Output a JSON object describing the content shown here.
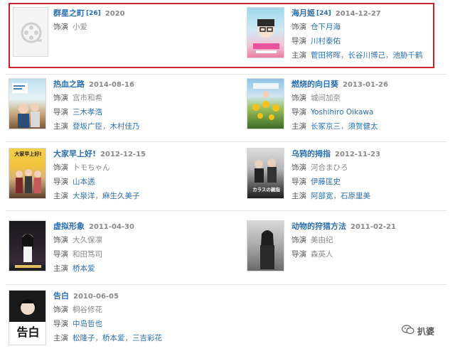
{
  "labels": {
    "voice": "饰演",
    "director": "导演",
    "lead": "主演"
  },
  "films": [
    {
      "title": "群星之町",
      "ref": "[26]",
      "date": "2020",
      "voice": [
        "小爱"
      ],
      "voice_link": false
    },
    {
      "title": "海月姬",
      "ref": "[24]",
      "date": "2014-12-27",
      "voice": [
        "仓下月海"
      ],
      "voice_link": true,
      "director": [
        "川村泰佑"
      ],
      "lead": [
        "菅田将晖",
        "长谷川博己",
        "池胁千鹤"
      ]
    },
    {
      "title": "热血之路",
      "date": "2014-08-16",
      "voice": [
        "宫市和希"
      ],
      "voice_link": false,
      "director": [
        "三木孝浩"
      ],
      "lead": [
        "登坂广臣",
        "木村佳乃"
      ]
    },
    {
      "title": "燃烧的向日葵",
      "date": "2013-01-26",
      "voice": [
        "城间加奈"
      ],
      "voice_link": false,
      "director": [
        "Yoshihiro Oikawa"
      ],
      "lead": [
        "长冢京三",
        "须贺健太"
      ]
    },
    {
      "title": "大家早上好!",
      "date": "2012-12-15",
      "voice": [
        "卜モちゃん"
      ],
      "voice_link": false,
      "director": [
        "山本透"
      ],
      "lead": [
        "大泉洋",
        "麻生久美子"
      ]
    },
    {
      "title": "乌鸦的拇指",
      "date": "2012-11-23",
      "voice": [
        "河合まひろ"
      ],
      "voice_link": false,
      "director": [
        "伊藤匡史"
      ],
      "lead": [
        "阿部宽",
        "石原里美"
      ]
    },
    {
      "title": "虚拟形象",
      "date": "2011-04-30",
      "voice": [
        "大久保凛"
      ],
      "voice_link": false,
      "director": [
        "和田笃司"
      ],
      "lead": [
        "桥本爱"
      ]
    },
    {
      "title": "动物的狩猎方法",
      "date": "2011-02-21",
      "voice": [
        "美由纪"
      ],
      "voice_link": false,
      "director": [
        "森英人"
      ]
    },
    {
      "title": "告白",
      "date": "2010-06-05",
      "voice": [
        "桐谷修花"
      ],
      "voice_link": false,
      "director": [
        "中岛哲也"
      ],
      "lead": [
        "松隆子",
        "桥本爱",
        "三吉彩花"
      ]
    }
  ],
  "posters": {
    "p8_text": "告白",
    "p5_text": "大家早上好!",
    "p6_text": "カラスの親指"
  },
  "watermark": {
    "text": "扒婆",
    "icon": "wechat-icon"
  }
}
